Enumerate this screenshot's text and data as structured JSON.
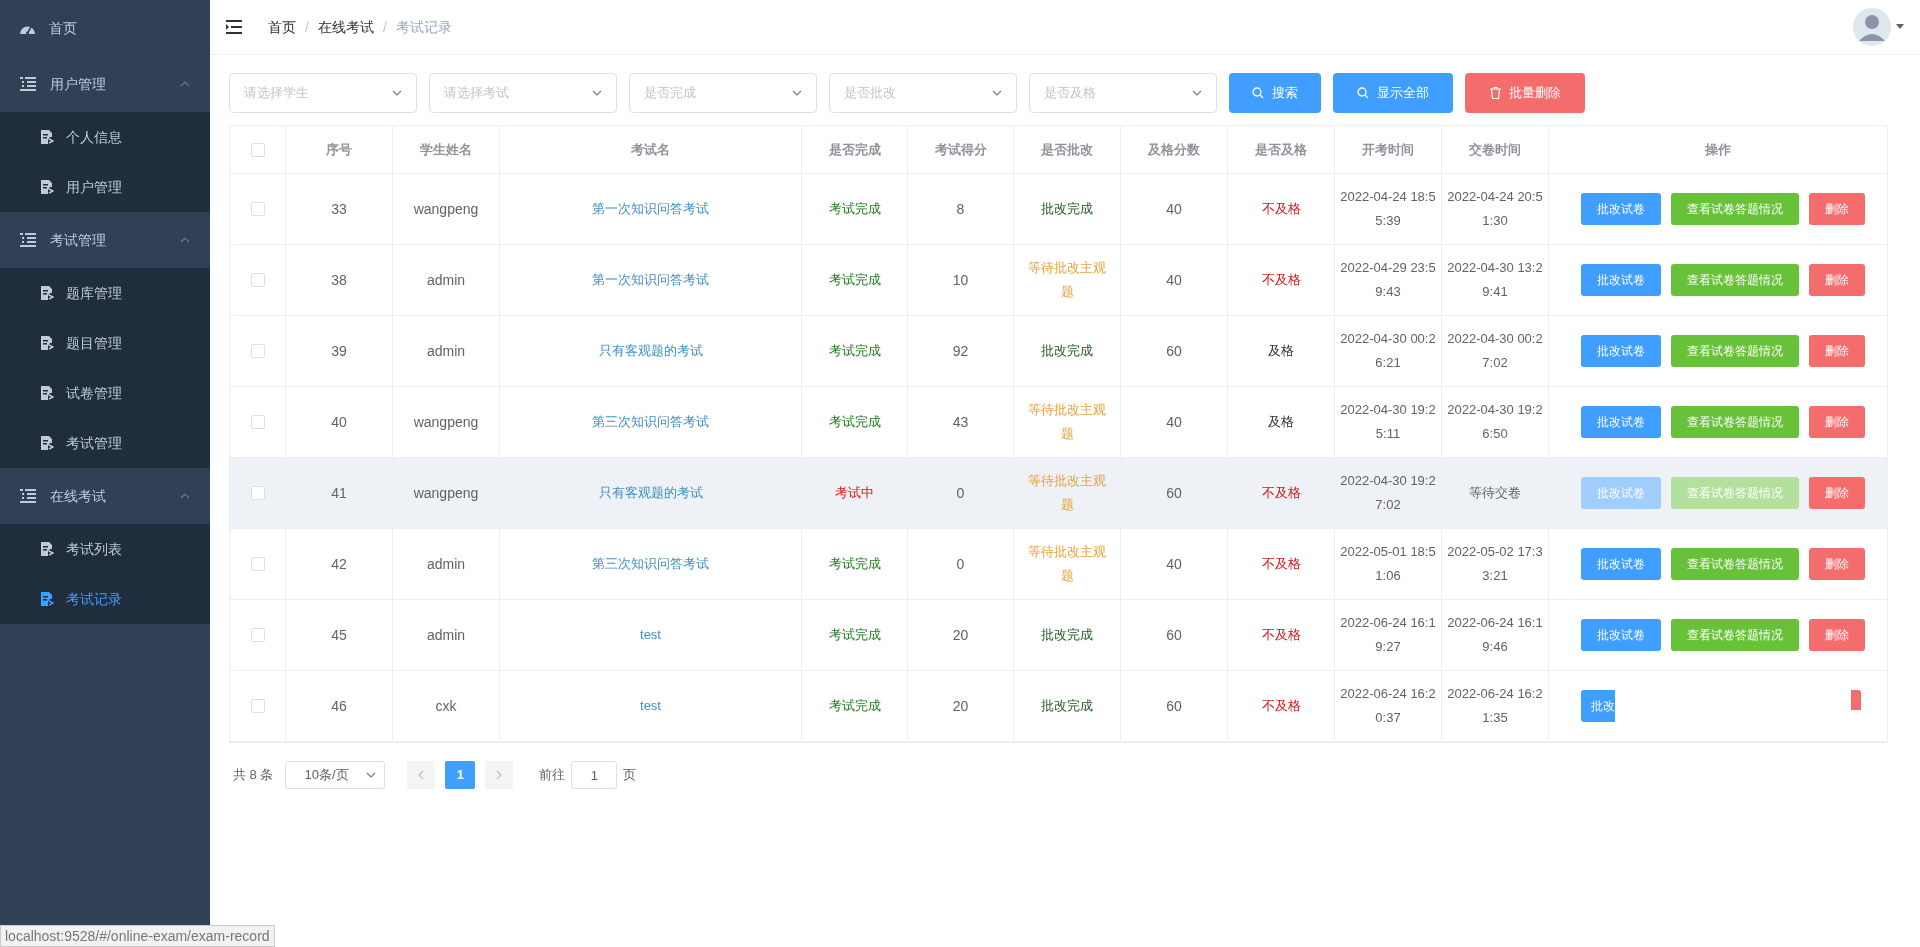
{
  "sidebar": {
    "items": [
      {
        "kind": "link",
        "label": "首页",
        "selected": false
      },
      {
        "kind": "group",
        "label": "用户管理",
        "expanded": true,
        "children": [
          {
            "label": "个人信息",
            "selected": false
          },
          {
            "label": "用户管理",
            "selected": false
          }
        ]
      },
      {
        "kind": "group",
        "label": "考试管理",
        "expanded": true,
        "children": [
          {
            "label": "题库管理",
            "selected": false
          },
          {
            "label": "题目管理",
            "selected": false
          },
          {
            "label": "试卷管理",
            "selected": false
          },
          {
            "label": "考试管理",
            "selected": false
          }
        ]
      },
      {
        "kind": "group",
        "label": "在线考试",
        "expanded": true,
        "children": [
          {
            "label": "考试列表",
            "selected": false
          },
          {
            "label": "考试记录",
            "selected": true
          }
        ]
      }
    ]
  },
  "breadcrumb": {
    "separator": "/",
    "items": [
      "首页",
      "在线考试",
      "考试记录"
    ]
  },
  "filters": [
    {
      "placeholder": "请选择学生"
    },
    {
      "placeholder": "请选择考试"
    },
    {
      "placeholder": "是否完成"
    },
    {
      "placeholder": "是否批改"
    },
    {
      "placeholder": "是否及格"
    }
  ],
  "toolbar_buttons": [
    {
      "kind": "search",
      "label": "搜索"
    },
    {
      "kind": "show_all",
      "label": "显示全部"
    },
    {
      "kind": "batch_delete",
      "label": "批量删除"
    }
  ],
  "table": {
    "select_all_checked": false,
    "columns": [
      "序号",
      "学生姓名",
      "考试名",
      "是否完成",
      "考试得分",
      "是否批改",
      "及格分数",
      "是否及格",
      "开考时间",
      "交卷时间",
      "操作"
    ],
    "rows": [
      {
        "checked": false,
        "highlighted": false,
        "id": "33",
        "student": "wangpeng",
        "exam": "第一次知识问答考试",
        "finished": {
          "label": "考试完成",
          "kind": "done"
        },
        "score": "8",
        "reviewed": {
          "label": "批改完成",
          "kind": "done"
        },
        "pass_score": "40",
        "passed": {
          "label": "不及格",
          "kind": "fail"
        },
        "start": "2022-04-24 18:55:39",
        "submit": "2022-04-24 20:51:30",
        "actions": [
          {
            "kind": "review",
            "label": "批改试卷",
            "disabled": false
          },
          {
            "kind": "view",
            "label": "查看试卷答题情况",
            "disabled": false
          },
          {
            "kind": "delete",
            "label": "删除",
            "disabled": false
          }
        ]
      },
      {
        "checked": false,
        "highlighted": false,
        "id": "38",
        "student": "admin",
        "exam": "第一次知识问答考试",
        "finished": {
          "label": "考试完成",
          "kind": "done"
        },
        "score": "10",
        "reviewed": {
          "label": "等待批改主观题",
          "kind": "waiting"
        },
        "pass_score": "40",
        "passed": {
          "label": "不及格",
          "kind": "fail"
        },
        "start": "2022-04-29 23:59:43",
        "submit": "2022-04-30 13:29:41",
        "actions": [
          {
            "kind": "review",
            "label": "批改试卷",
            "disabled": false
          },
          {
            "kind": "view",
            "label": "查看试卷答题情况",
            "disabled": false
          },
          {
            "kind": "delete",
            "label": "删除",
            "disabled": false
          }
        ]
      },
      {
        "checked": false,
        "highlighted": false,
        "id": "39",
        "student": "admin",
        "exam": "只有客观题的考试",
        "finished": {
          "label": "考试完成",
          "kind": "done"
        },
        "score": "92",
        "reviewed": {
          "label": "批改完成",
          "kind": "done"
        },
        "pass_score": "60",
        "passed": {
          "label": "及格",
          "kind": "pass"
        },
        "start": "2022-04-30 00:26:21",
        "submit": "2022-04-30 00:27:02",
        "actions": [
          {
            "kind": "review",
            "label": "批改试卷",
            "disabled": false
          },
          {
            "kind": "view",
            "label": "查看试卷答题情况",
            "disabled": false
          },
          {
            "kind": "delete",
            "label": "删除",
            "disabled": false
          }
        ]
      },
      {
        "checked": false,
        "highlighted": false,
        "id": "40",
        "student": "wangpeng",
        "exam": "第三次知识问答考试",
        "finished": {
          "label": "考试完成",
          "kind": "done"
        },
        "score": "43",
        "reviewed": {
          "label": "等待批改主观题",
          "kind": "waiting"
        },
        "pass_score": "40",
        "passed": {
          "label": "及格",
          "kind": "pass"
        },
        "start": "2022-04-30 19:25:11",
        "submit": "2022-04-30 19:26:50",
        "actions": [
          {
            "kind": "review",
            "label": "批改试卷",
            "disabled": false
          },
          {
            "kind": "view",
            "label": "查看试卷答题情况",
            "disabled": false
          },
          {
            "kind": "delete",
            "label": "删除",
            "disabled": false
          }
        ]
      },
      {
        "checked": false,
        "highlighted": true,
        "id": "41",
        "student": "wangpeng",
        "exam": "只有客观题的考试",
        "finished": {
          "label": "考试中",
          "kind": "ongoing"
        },
        "score": "0",
        "reviewed": {
          "label": "等待批改主观题",
          "kind": "waiting"
        },
        "pass_score": "60",
        "passed": {
          "label": "不及格",
          "kind": "fail"
        },
        "start": "2022-04-30 19:27:02",
        "submit": "等待交卷",
        "actions": [
          {
            "kind": "review",
            "label": "批改试卷",
            "disabled": true
          },
          {
            "kind": "view",
            "label": "查看试卷答题情况",
            "disabled": true
          },
          {
            "kind": "delete",
            "label": "删除",
            "disabled": false
          }
        ]
      },
      {
        "checked": false,
        "highlighted": false,
        "id": "42",
        "student": "admin",
        "exam": "第三次知识问答考试",
        "finished": {
          "label": "考试完成",
          "kind": "done"
        },
        "score": "0",
        "reviewed": {
          "label": "等待批改主观题",
          "kind": "waiting"
        },
        "pass_score": "40",
        "passed": {
          "label": "不及格",
          "kind": "fail"
        },
        "start": "2022-05-01 18:51:06",
        "submit": "2022-05-02 17:33:21",
        "actions": [
          {
            "kind": "review",
            "label": "批改试卷",
            "disabled": false
          },
          {
            "kind": "view",
            "label": "查看试卷答题情况",
            "disabled": false
          },
          {
            "kind": "delete",
            "label": "删除",
            "disabled": false
          }
        ]
      },
      {
        "checked": false,
        "highlighted": false,
        "id": "45",
        "student": "admin",
        "exam": "test",
        "finished": {
          "label": "考试完成",
          "kind": "done"
        },
        "score": "20",
        "reviewed": {
          "label": "批改完成",
          "kind": "done"
        },
        "pass_score": "60",
        "passed": {
          "label": "不及格",
          "kind": "fail"
        },
        "start": "2022-06-24 16:19:27",
        "submit": "2022-06-24 16:19:46",
        "actions": [
          {
            "kind": "review",
            "label": "批改试卷",
            "disabled": false
          },
          {
            "kind": "view",
            "label": "查看试卷答题情况",
            "disabled": false
          },
          {
            "kind": "delete",
            "label": "删除",
            "disabled": false
          }
        ]
      },
      {
        "checked": false,
        "highlighted": false,
        "id": "46",
        "student": "cxk",
        "exam": "test",
        "finished": {
          "label": "考试完成",
          "kind": "done"
        },
        "score": "20",
        "reviewed": {
          "label": "批改完成",
          "kind": "done"
        },
        "pass_score": "60",
        "passed": {
          "label": "不及格",
          "kind": "fail"
        },
        "start": "2022-06-24 16:20:37",
        "submit": "2022-06-24 16:21:35",
        "actions": [
          {
            "kind": "review_partial",
            "label": "批改",
            "disabled": false
          },
          {
            "kind": "delete_partial",
            "disabled": false
          }
        ]
      }
    ]
  },
  "pagination": {
    "total": "共 8 条",
    "page_size": "10条/页",
    "pages": [
      {
        "label": "1",
        "selected": true
      }
    ],
    "goto_label": "前往",
    "goto_value": "1",
    "goto_suffix": "页"
  },
  "status_url": "localhost:9528/#/online-exam/exam-record"
}
